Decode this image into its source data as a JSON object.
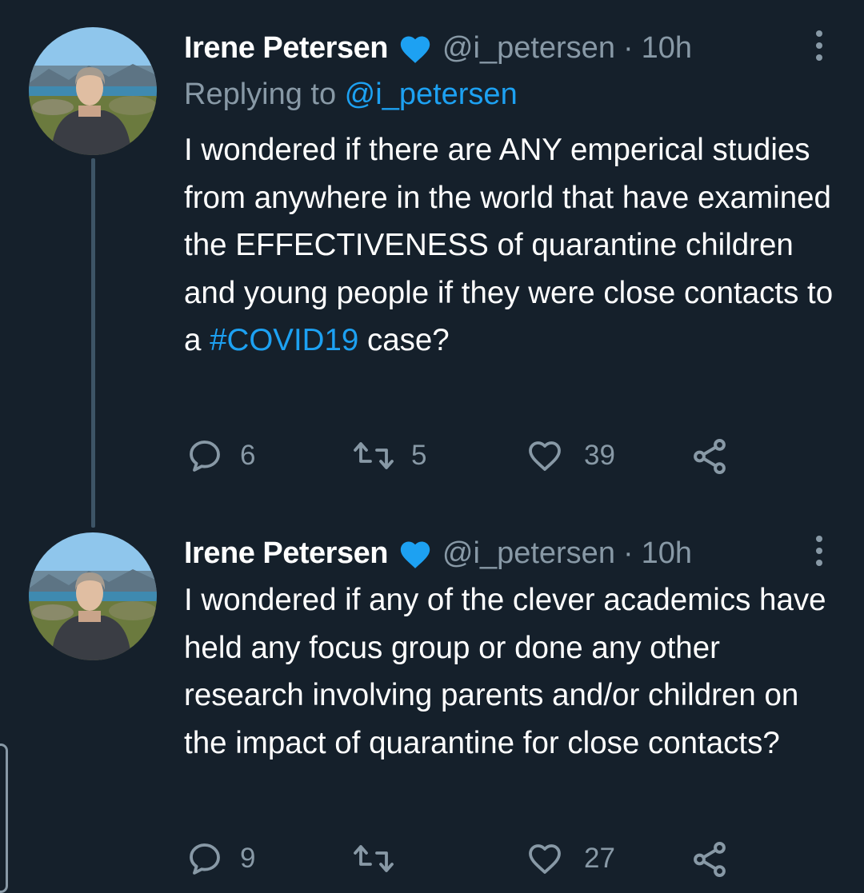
{
  "tweets": [
    {
      "author_name": "Irene Petersen",
      "handle": "@i_petersen",
      "separator": "·",
      "time": "10h",
      "replying_label": "Replying to ",
      "replying_handle": "@i_petersen",
      "text_before": "I wondered if there are ANY emperical studies from anywhere in the world that have examined the EFFECTIVENESS of quarantine children and young people if they were close contacts to a ",
      "hashtag": "#COVID19",
      "text_after": " case?",
      "replies": "6",
      "retweets": "5",
      "likes": "39"
    },
    {
      "author_name": "Irene Petersen",
      "handle": "@i_petersen",
      "separator": "·",
      "time": "10h",
      "text": "I wondered if any of the clever academics have held any focus group or done any other research involving parents and/or children on the impact of quarantine for close contacts?",
      "replies": "9",
      "retweets": "",
      "likes": "27"
    }
  ],
  "colors": {
    "background": "#15202b",
    "secondary_text": "#8899a6",
    "accent": "#1da1f2",
    "verified_badge": "#1da1f2",
    "thread_line": "#3d5466"
  },
  "icons": [
    "verified-badge-icon",
    "more-options-icon",
    "reply-icon",
    "retweet-icon",
    "like-icon",
    "share-icon"
  ]
}
